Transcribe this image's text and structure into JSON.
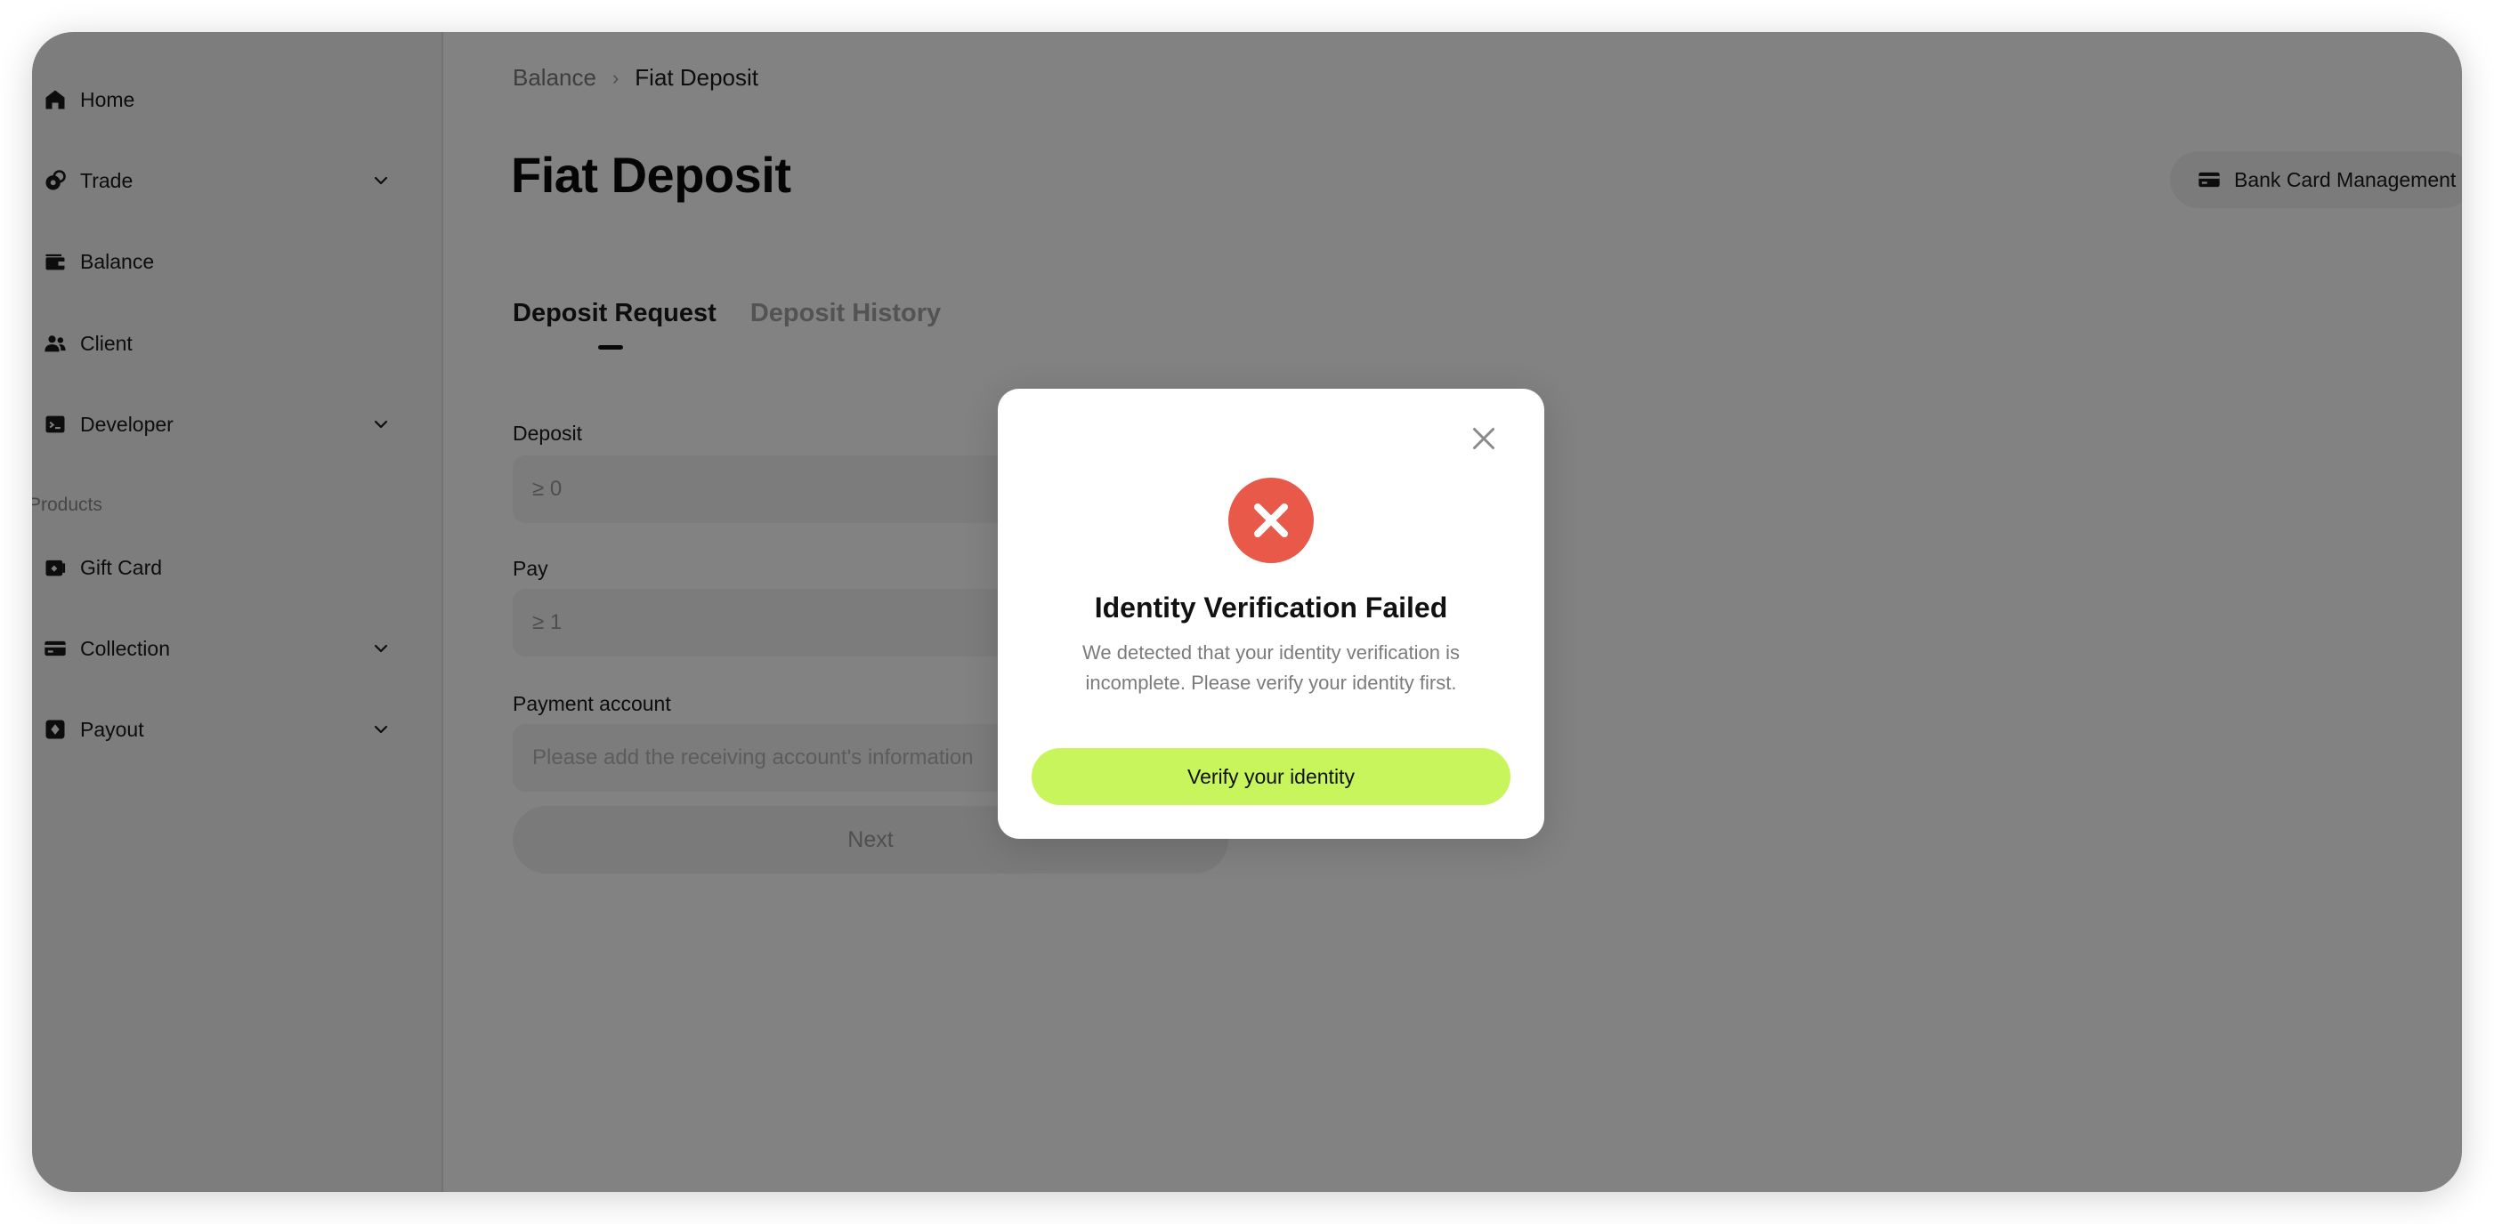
{
  "sidebar": {
    "items": [
      {
        "label": "Home",
        "icon": "home-icon"
      },
      {
        "label": "Trade",
        "icon": "trade-icon"
      },
      {
        "label": "Balance",
        "icon": "wallet-icon"
      },
      {
        "label": "Client",
        "icon": "users-icon"
      },
      {
        "label": "Developer",
        "icon": "terminal-icon"
      },
      {
        "label": "Gift Card",
        "icon": "gift-card-icon"
      },
      {
        "label": "Collection",
        "icon": "card-icon"
      },
      {
        "label": "Payout",
        "icon": "payout-icon"
      }
    ],
    "section_label": "Products"
  },
  "breadcrumb": {
    "parent": "Balance",
    "separator": "›",
    "current": "Fiat Deposit"
  },
  "page": {
    "title": "Fiat Deposit",
    "bank_button": "Bank Card Management"
  },
  "tabs": [
    {
      "label": "Deposit Request",
      "active": true
    },
    {
      "label": "Deposit History",
      "active": false
    }
  ],
  "form": {
    "deposit_label": "Deposit",
    "deposit_placeholder": "≥ 0",
    "pay_label": "Pay",
    "pay_placeholder": "≥ 1",
    "account_label": "Payment account",
    "account_placeholder": "Please add the receiving account's information",
    "next_label": "Next"
  },
  "modal": {
    "title": "Identity Verification Failed",
    "message": "We detected that your identity verification is incomplete. Please verify your identity first.",
    "button": "Verify your identity"
  },
  "colors": {
    "accent": "#c8f55c",
    "error": "#e8594a",
    "overlay": "rgba(0,0,0,0.49)"
  }
}
